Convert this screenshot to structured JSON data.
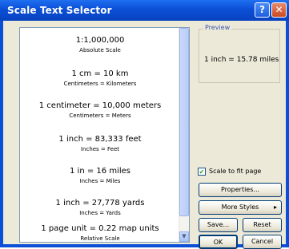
{
  "window": {
    "title": "Scale Text Selector",
    "help_label": "?",
    "close_label": "✕"
  },
  "list": {
    "items": [
      {
        "main": "1:1,000,000",
        "sub": "Absolute Scale"
      },
      {
        "main": "1 cm = 10 km",
        "sub": "Centimeters = Kilometers"
      },
      {
        "main": "1 centimeter = 10,000 meters",
        "sub": "Centimeters = Meters"
      },
      {
        "main": "1 inch = 83,333 feet",
        "sub": "Inches = Feet"
      },
      {
        "main": "1 in = 16 miles",
        "sub": "Inches = Miles"
      },
      {
        "main": "1 inch = 27,778 yards",
        "sub": "Inches = Yards"
      },
      {
        "main": "1 page unit = 0.22 map units",
        "sub": "Relative Scale"
      }
    ]
  },
  "preview": {
    "label": "Preview",
    "text": "1 inch = 15.78 miles"
  },
  "options": {
    "scale_to_fit_label": "Scale to fit page",
    "scale_to_fit_checked": true,
    "check_mark": "✔"
  },
  "buttons": {
    "properties": "Properties...",
    "more_styles": "More Styles",
    "more_styles_arrow": "▸",
    "save": "Save...",
    "reset": "Reset",
    "ok": "OK",
    "cancel": "Cancel"
  },
  "scrollbar": {
    "down_arrow": "▼"
  }
}
